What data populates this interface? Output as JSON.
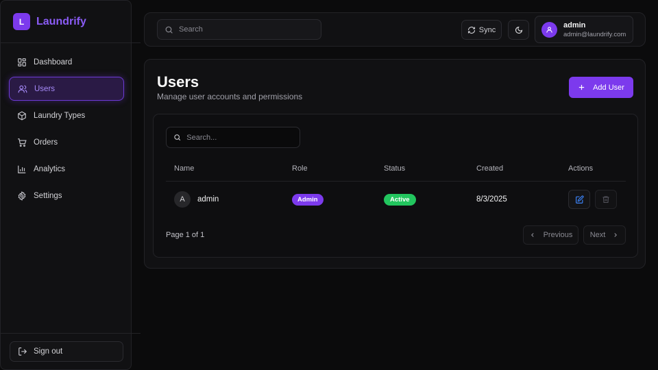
{
  "brand": {
    "logo_letter": "L",
    "name": "Laundrify",
    "accent": "#7c3aed"
  },
  "sidebar": {
    "items": [
      {
        "label": "Dashboard",
        "icon": "dashboard-icon",
        "active": false
      },
      {
        "label": "Users",
        "icon": "users-icon",
        "active": true
      },
      {
        "label": "Laundry Types",
        "icon": "package-icon",
        "active": false
      },
      {
        "label": "Orders",
        "icon": "cart-icon",
        "active": false
      },
      {
        "label": "Analytics",
        "icon": "bar-chart-icon",
        "active": false
      },
      {
        "label": "Settings",
        "icon": "gear-icon",
        "active": false
      }
    ],
    "sign_out": "Sign out"
  },
  "header": {
    "search_placeholder": "Search",
    "sync_label": "Sync",
    "theme_icon": "moon-icon",
    "user": {
      "name": "admin",
      "email": "admin@laundrify.com"
    }
  },
  "main": {
    "title": "Users",
    "subtitle": "Manage user accounts and permissions",
    "add_user_label": "Add User",
    "table_search_placeholder": "Search...",
    "columns": [
      "Name",
      "Role",
      "Status",
      "Created",
      "Actions"
    ],
    "rows": [
      {
        "avatar_letter": "A",
        "name": "admin",
        "role": "Admin",
        "status": "Active",
        "created": "8/3/2025"
      }
    ],
    "pagination": {
      "info": "Page 1 of 1",
      "previous": "Previous",
      "next": "Next"
    }
  },
  "colors": {
    "active_badge": "#22c55e",
    "role_badge": "#7c3aed",
    "edit_icon": "#3b82f6"
  }
}
